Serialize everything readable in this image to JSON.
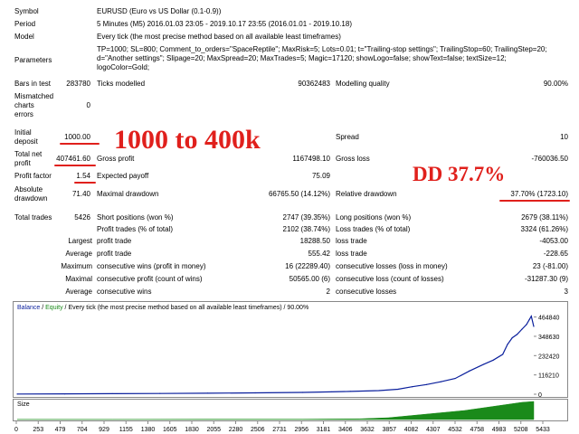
{
  "rows": {
    "symbol_label": "Symbol",
    "symbol_value": "EURUSD (Euro vs US Dollar (0.1-0.9))",
    "period_label": "Period",
    "period_value": "5 Minutes (M5) 2016.01.03 23:05 - 2019.10.17 23:55 (2016.01.01 - 2019.10.18)",
    "model_label": "Model",
    "model_value": "Every tick (the most precise method based on all available least timeframes)",
    "parameters_label": "Parameters",
    "parameters_line1": "TP=1000; SL=800; Comment_to_orders=\"SpaceReptile\"; MaxRisk=5; Lots=0.01; t=\"Trailing-stop settings\"; TrailingStop=60; TrailingStep=20;",
    "parameters_line2": "d=\"Another settings\"; Slipage=20; MaxSpread=20; MaxTrades=5; Magic=17120; showLogo=false; showText=false; textSize=12;",
    "parameters_line3": "logoColor=Gold;",
    "bars_label": "Bars in test",
    "bars_value": "283780",
    "ticks_label": "Ticks modelled",
    "ticks_value": "90362483",
    "quality_label": "Modelling quality",
    "quality_value": "90.00%",
    "mismatch_label_1": "Mismatched",
    "mismatch_label_2": "charts",
    "mismatch_label_3": "errors",
    "mismatch_value": "0",
    "deposit_label_1": "Initial",
    "deposit_label_2": "deposit",
    "deposit_value": "1000.00",
    "spread_label": "Spread",
    "spread_value": "10",
    "net_profit_label_1": "Total net",
    "net_profit_label_2": "profit",
    "net_profit_value": "407461.60",
    "gross_profit_label": "Gross profit",
    "gross_profit_value": "1167498.10",
    "gross_loss_label": "Gross loss",
    "gross_loss_value": "-760036.50",
    "profit_factor_label": "Profit factor",
    "profit_factor_value": "1.54",
    "expected_payoff_label": "Expected payoff",
    "expected_payoff_value": "75.09",
    "abs_dd_label_1": "Absolute",
    "abs_dd_label_2": "drawdown",
    "abs_dd_value": "71.40",
    "max_dd_label": "Maximal drawdown",
    "max_dd_value": "66765.50 (14.12%)",
    "rel_dd_label": "Relative drawdown",
    "rel_dd_value": "37.70% (1723.10)",
    "total_trades_label": "Total trades",
    "total_trades_value": "5426",
    "short_label": "Short positions (won %)",
    "short_value": "2747 (39.35%)",
    "long_label": "Long positions (won %)",
    "long_value": "2679 (38.11%)",
    "profit_trades_label": "Profit trades (% of total)",
    "profit_trades_value": "2102 (38.74%)",
    "loss_trades_label": "Loss trades (% of total)",
    "loss_trades_value": "3324 (61.26%)",
    "largest_label": "Largest",
    "largest_profit_label": "profit trade",
    "largest_profit_value": "18288.50",
    "largest_loss_label": "loss trade",
    "largest_loss_value": "-4053.00",
    "average_label": "Average",
    "average_profit_label": "profit trade",
    "average_profit_value": "555.42",
    "average_loss_label": "loss trade",
    "average_loss_value": "-228.65",
    "maximum_label": "Maximum",
    "max_cons_wins_label": "consecutive wins (profit in money)",
    "max_cons_wins_value": "16 (22289.40)",
    "max_cons_losses_label": "consecutive losses (loss in money)",
    "max_cons_losses_value": "23 (-81.00)",
    "maximal_label": "Maximal",
    "maximal_cons_profit_label": "consecutive profit (count of wins)",
    "maximal_cons_profit_value": "50565.00 (6)",
    "maximal_cons_loss_label": "consecutive loss (count of losses)",
    "maximal_cons_loss_value": "-31287.30 (9)",
    "avg_label": "Average",
    "avg_cons_wins_label": "consecutive wins",
    "avg_cons_wins_value": "2",
    "avg_cons_losses_label": "consecutive losses",
    "avg_cons_losses_value": "3"
  },
  "annotations": {
    "growth": "1000 to 400k",
    "drawdown": "DD 37.7%"
  },
  "colors": {
    "annotation_red": "#e0201c",
    "balance_line": "#0a1f9c",
    "equity_line": "#1a8a1a",
    "size_bars": "#1a8a1a"
  },
  "chart_data": [
    {
      "type": "line",
      "legend": {
        "balance": "Balance",
        "separator1": " / ",
        "equity": "Equity",
        "rest": " / Every tick (the most precise method based on all available least timeframes) / 90.00%"
      },
      "y_ticks": [
        "464840",
        "348630",
        "232420",
        "116210",
        "0"
      ],
      "ylim": [
        0,
        490000
      ],
      "xlim": [
        0,
        5426
      ],
      "series": [
        {
          "name": "Balance",
          "x": [
            0,
            500,
            1000,
            1500,
            2000,
            2500,
            3000,
            3300,
            3500,
            3800,
            4000,
            4150,
            4300,
            4450,
            4600,
            4750,
            4900,
            5000,
            5100,
            5150,
            5200,
            5250,
            5300,
            5350,
            5380,
            5400,
            5426
          ],
          "y": [
            1000,
            2000,
            3000,
            4500,
            6000,
            8000,
            11000,
            14000,
            17000,
            22000,
            30000,
            45000,
            58000,
            75000,
            95000,
            140000,
            180000,
            205000,
            240000,
            300000,
            340000,
            360000,
            390000,
            420000,
            450000,
            470000,
            408000
          ]
        }
      ]
    },
    {
      "type": "bar",
      "title": "Size",
      "x_ticks": [
        "0",
        "253",
        "479",
        "704",
        "929",
        "1155",
        "1380",
        "1605",
        "1830",
        "2055",
        "2280",
        "2506",
        "2731",
        "2956",
        "3181",
        "3406",
        "3632",
        "3857",
        "4082",
        "4307",
        "4532",
        "4758",
        "4983",
        "5208",
        "5433"
      ],
      "series": [
        {
          "name": "Size",
          "x": [
            0,
            1000,
            2000,
            3000,
            3600,
            3900,
            4100,
            4300,
            4500,
            4700,
            4900,
            5100,
            5300,
            5426
          ],
          "y": [
            0.01,
            0.01,
            0.02,
            0.02,
            0.04,
            0.1,
            0.2,
            0.3,
            0.4,
            0.5,
            0.65,
            0.8,
            0.95,
            1.0
          ]
        }
      ]
    }
  ]
}
